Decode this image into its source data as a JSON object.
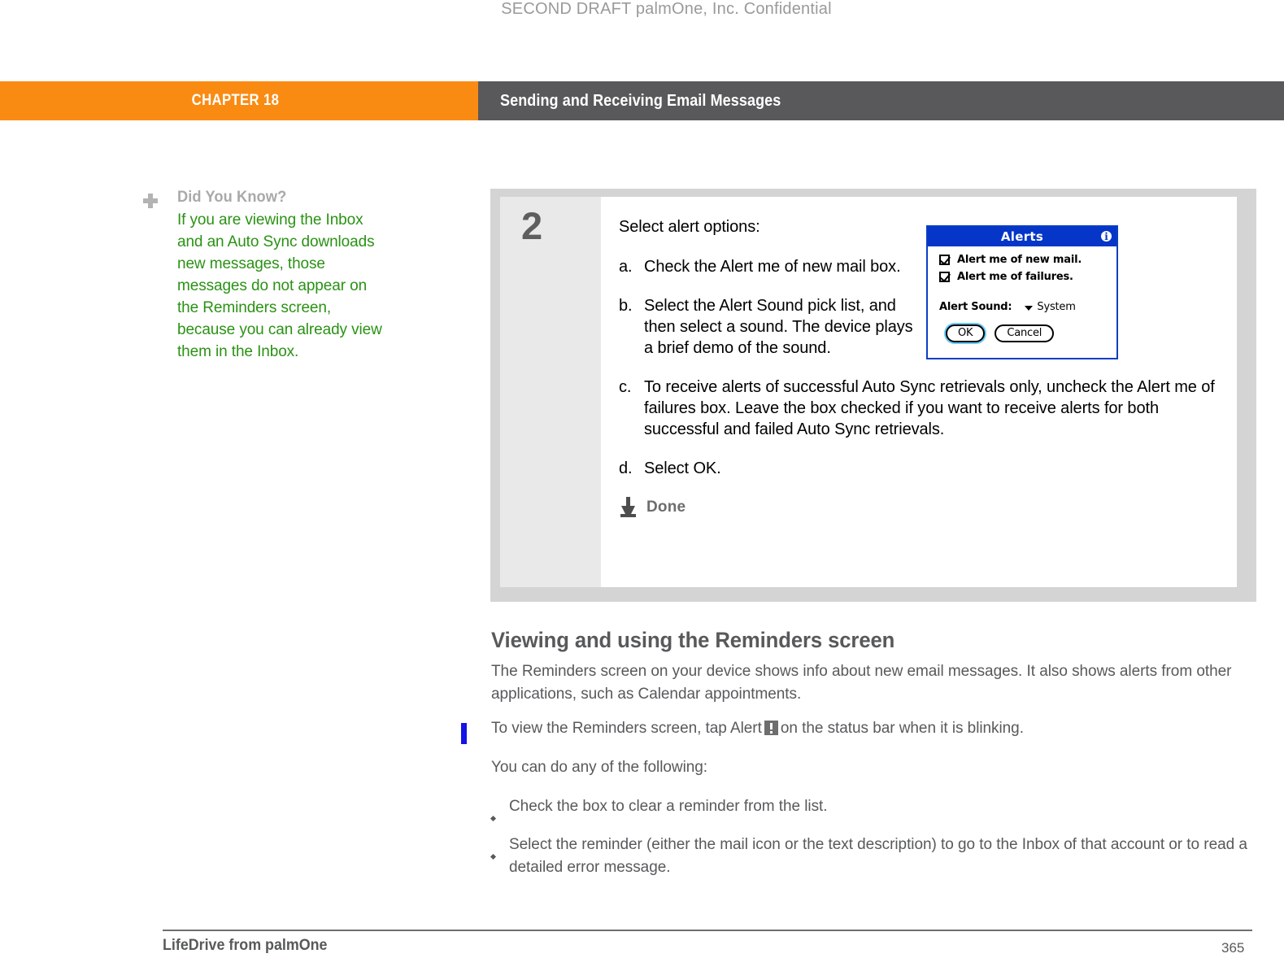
{
  "watermark": "SECOND DRAFT palmOne, Inc.  Confidential",
  "header": {
    "chapter_label": "CHAPTER 18",
    "chapter_title": "Sending and Receiving Email Messages",
    "orange": "#f98b13",
    "gray": "#59595b"
  },
  "sidenote": {
    "icon": "plus-icon",
    "title": "Did You Know?",
    "body": "If you are viewing the Inbox and an Auto Sync downloads new messages, those messages do not appear on the Reminders screen, because you can already view them in the Inbox.",
    "text_color": "#2a9214"
  },
  "step": {
    "number": "2",
    "lead": "Select alert options:",
    "substeps": [
      {
        "marker": "a.",
        "text": "Check the Alert me of new mail box."
      },
      {
        "marker": "b.",
        "text": "Select the Alert Sound pick list, and then select a sound. The device plays a brief demo of the sound."
      },
      {
        "marker": "c.",
        "text": "To receive alerts of successful Auto Sync retrievals only, uncheck the Alert me of failures box. Leave the box checked if you want to receive alerts for both successful and failed Auto Sync retrievals."
      },
      {
        "marker": "d.",
        "text": "Select OK."
      }
    ],
    "done_label": "Done"
  },
  "alerts_dialog": {
    "title": "Alerts",
    "info_icon": "i",
    "checkboxes": [
      {
        "label": "Alert me of new mail.",
        "checked": true
      },
      {
        "label": "Alert me of failures.",
        "checked": true
      }
    ],
    "sound_label": "Alert Sound:",
    "sound_value": "System",
    "ok_label": "OK",
    "cancel_label": "Cancel",
    "title_bar_color": "#0536c8"
  },
  "section": {
    "heading": "Viewing and using the Reminders screen",
    "para_1": "The Reminders screen on your device shows info about new email messages. It also shows alerts from other applications, such as Calendar appointments.",
    "para_2_before": "To view the Reminders screen, tap Alert",
    "para_2_after": "on the status bar when it is blinking.",
    "para_3": "You can do any of the following:",
    "bullets": [
      "Check the box to clear a reminder from the list.",
      "Select the reminder (either the mail icon or the text description) to go to the Inbox of that account or to read a detailed error message."
    ]
  },
  "footer": {
    "left": "LifeDrive from palmOne",
    "page": "365"
  }
}
